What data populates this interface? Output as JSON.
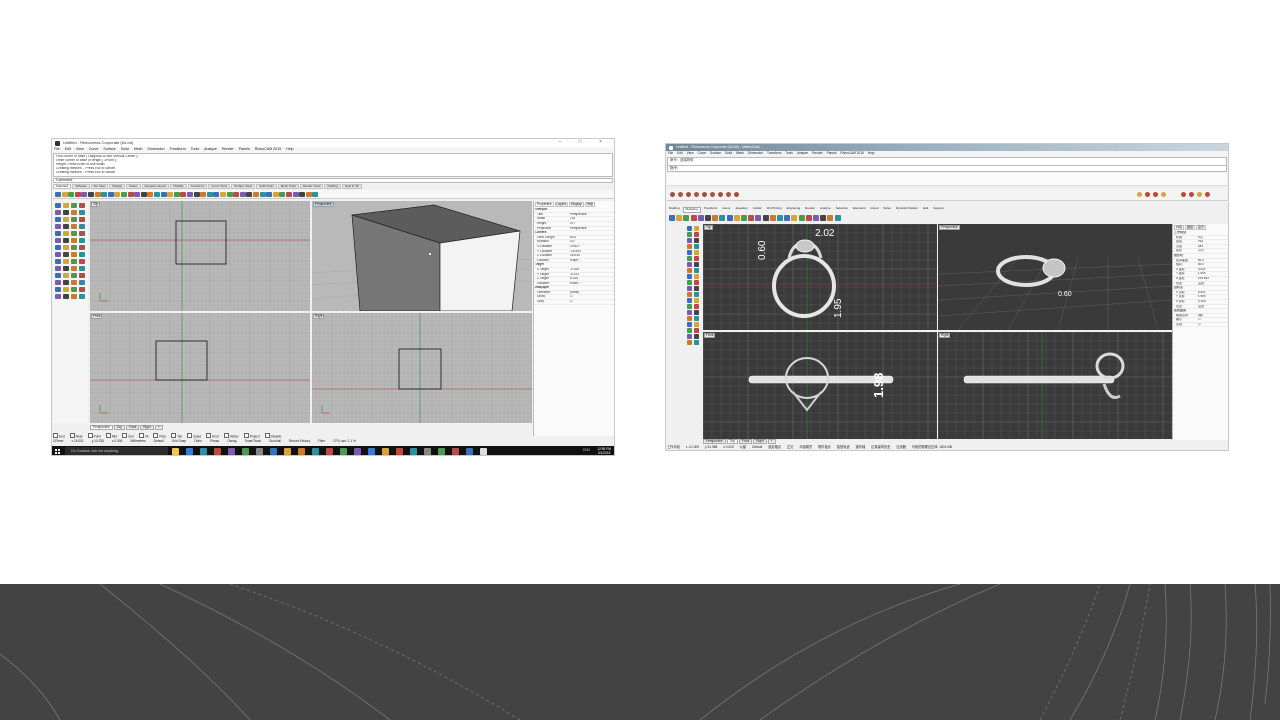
{
  "colors": {
    "page_bg": "#ffffff",
    "band_bg": "#434343",
    "band_lines": "#8a8a8a",
    "rhino_viewport_bg": "#b9b9b9",
    "rhino_grid": "#a4a4a4",
    "matrix_viewport_bg": "#3a3a3a",
    "matrix_grid": "#6a6a6a",
    "x_axis": "#b23838",
    "y_axis": "#2f8a3c",
    "dimension_text": "#ffffff"
  },
  "left": {
    "title": "Untitled - Rhinoceros Corporate (64-bit)",
    "window_buttons": "– □ ×",
    "menu": [
      "File",
      "Edit",
      "View",
      "Curve",
      "Surface",
      "Solid",
      "Mesh",
      "Dimension",
      "Transform",
      "Tools",
      "Analyze",
      "Render",
      "Panels",
      "RhinoCAM 2015",
      "Help"
    ],
    "history": [
      "First corner of base ( Diagonal 3Point Vertical Center ):",
      "Other corner of base or length ( 3Point ):",
      "Height. Press Enter to use width:",
      "Creating meshes... Press Esc to cancel",
      "Creating meshes... Press Esc to cancel"
    ],
    "command": "Command:",
    "tabs": [
      "Standard",
      "CPlanes",
      "Set View",
      "Display",
      "Select",
      "Viewport Layout",
      "Visibility",
      "Transform",
      "Curve Tools",
      "Surface Tools",
      "Solid Tools",
      "Mesh Tools",
      "Render Tools",
      "Drafting",
      "New in V5"
    ],
    "viewports": {
      "top": "Top",
      "perspective": "Perspective",
      "front": "Front",
      "right": "Right"
    },
    "panel_tabs": [
      "Properties",
      "Layers",
      "Display",
      "Help"
    ],
    "properties": [
      {
        "k": "Viewport",
        "v": "",
        "sect": true
      },
      {
        "k": "Title",
        "v": "Perspective"
      },
      {
        "k": "Width",
        "v": "742"
      },
      {
        "k": "Height",
        "v": "377"
      },
      {
        "k": "Projection",
        "v": "Perspective"
      },
      {
        "k": "Camera",
        "v": "",
        "sect": true
      },
      {
        "k": "Lens Length",
        "v": "50.0"
      },
      {
        "k": "Rotation",
        "v": "0.0"
      },
      {
        "k": "X Location",
        "v": "19.627"
      },
      {
        "k": "Y Location",
        "v": "-18.543"
      },
      {
        "k": "Z Location",
        "v": "16.935"
      },
      {
        "k": "Location",
        "v": "Place..."
      },
      {
        "k": "Target",
        "v": "",
        "sect": true
      },
      {
        "k": "X Target",
        "v": "-0.334"
      },
      {
        "k": "Y Target",
        "v": "-8.413"
      },
      {
        "k": "Z Target",
        "v": "8.106"
      },
      {
        "k": "Location",
        "v": "Place..."
      },
      {
        "k": "Wallpaper",
        "v": "",
        "sect": true
      },
      {
        "k": "Filename",
        "v": "(none)"
      },
      {
        "k": "Show",
        "v": "☑"
      },
      {
        "k": "Gray",
        "v": "☑"
      }
    ],
    "vp_tabs": [
      "Perspective",
      "Top",
      "Front",
      "Right",
      "+"
    ],
    "osnaps": [
      "End",
      "Near",
      "Point",
      "Mid",
      "Cen",
      "Int",
      "Perp",
      "Tan",
      "Quad",
      "Knot",
      "Vertex",
      "Project",
      "Disable"
    ],
    "status": [
      "CPlane",
      "x 15.001",
      "y 10.335",
      "z 0.000",
      "Millimeters",
      "Default",
      "Grid Snap",
      "Ortho",
      "Planar",
      "Osnap",
      "SmartTrack",
      "Gumball",
      "Record History",
      "Filter",
      "CPU use: 1.1 %"
    ],
    "taskbar": {
      "search": "I'm Cortana. Ask me anything.",
      "tray": "ENG",
      "time": "12:55 PM",
      "date": "3/1/2016"
    }
  },
  "right": {
    "title": "Untitled - Rhinoceros Corporate (64-bit) - MatrixGold",
    "history": [
      "指令：",
      "命令：选择物件"
    ],
    "prompt": "指令:",
    "tabs": [
      "Drafting",
      "Modeling",
      "Transform",
      "Gems",
      "Jewellery",
      "Artistic",
      "3D Printing",
      "Engraving",
      "Render",
      "Analyze",
      "Selection",
      "Elements",
      "Cloud",
      "Solve",
      "Dynamic Pattern",
      "Edit",
      "Support"
    ],
    "viewports": {
      "top": "Top",
      "perspective": "Perspective",
      "front": "Front",
      "right": "Right"
    },
    "dimensions": {
      "d1": "2.02",
      "d2": "0.60",
      "d3": "1.95",
      "d4": "1.98",
      "d5": "0.60"
    },
    "panel_tabs": [
      "内容",
      "图层",
      "显示"
    ],
    "properties": [
      {
        "k": "工作视窗",
        "v": "",
        "sect": true
      },
      {
        "k": "标题",
        "v": "Top"
      },
      {
        "k": "宽度",
        "v": "794"
      },
      {
        "k": "高度",
        "v": "284"
      },
      {
        "k": "投影",
        "v": "平行"
      },
      {
        "k": "摄影机",
        "v": "",
        "sect": true
      },
      {
        "k": "镜头焦距",
        "v": "50.0"
      },
      {
        "k": "旋转",
        "v": "90.0"
      },
      {
        "k": "X 座标",
        "v": "0.021"
      },
      {
        "k": "Y 座标",
        "v": "1.505"
      },
      {
        "k": "Z 座标",
        "v": "215.994"
      },
      {
        "k": "位置",
        "v": "设置"
      },
      {
        "k": "目标点",
        "v": "",
        "sect": true
      },
      {
        "k": "X 目标",
        "v": "0.021"
      },
      {
        "k": "Y 目标",
        "v": "1.505"
      },
      {
        "k": "Z 目标",
        "v": "0.160"
      },
      {
        "k": "位置",
        "v": "设置"
      },
      {
        "k": "底色图案",
        "v": "",
        "sect": true
      },
      {
        "k": "檔案名称",
        "v": "(無)"
      },
      {
        "k": "顯示",
        "v": "☑"
      },
      {
        "k": "灰階",
        "v": "☑"
      }
    ],
    "vp_tabs": [
      "Perspective",
      "Top",
      "Front",
      "Right",
      "+"
    ],
    "status": [
      "工作平面",
      "x -21.309",
      "y 31.988",
      "z 0.000",
      "公厘",
      "Default",
      "锁定格点",
      "正交",
      "平面模式",
      "物件锁点",
      "智慧轨迹",
      "操作轴",
      "记录建构历史",
      "过滤器",
      "可用的物理记忆体: 1604 MB"
    ]
  }
}
